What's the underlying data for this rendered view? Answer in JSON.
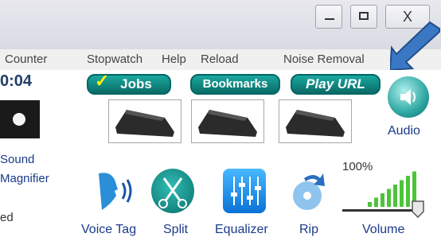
{
  "window": {
    "minimize_glyph": "▭",
    "maximize_glyph": "▣",
    "close_glyph": "X"
  },
  "menu": [
    "Counter",
    "Stopwatch",
    "Help",
    "Reload",
    "Noise Removal"
  ],
  "timer": "0:04",
  "buttons": {
    "jobs": "Jobs",
    "bookmarks": "Bookmarks",
    "play_url": "Play URL"
  },
  "audio_label": "Audio",
  "left_panel": {
    "sound": "Sound",
    "magnifier": "Magnifier",
    "ed": "ed"
  },
  "tools": {
    "voice_tag": "Voice Tag",
    "split": "Split",
    "equalizer": "Equalizer",
    "rip": "Rip",
    "volume": "Volume"
  },
  "volume_percent": "100%",
  "volume_level": 1.0,
  "colors": {
    "accent_teal": "#0a6b66",
    "label_blue": "#1a3a8a",
    "arrow_blue": "#3b78c4"
  },
  "icons": [
    "minimize-icon",
    "maximize-icon",
    "close-icon",
    "checkmark-icon",
    "foot-pedal-icon",
    "speaker-icon",
    "record-icon",
    "voice-tag-icon",
    "scissors-icon",
    "equalizer-icon",
    "rip-disc-icon",
    "volume-bars-icon",
    "arrow-icon"
  ]
}
